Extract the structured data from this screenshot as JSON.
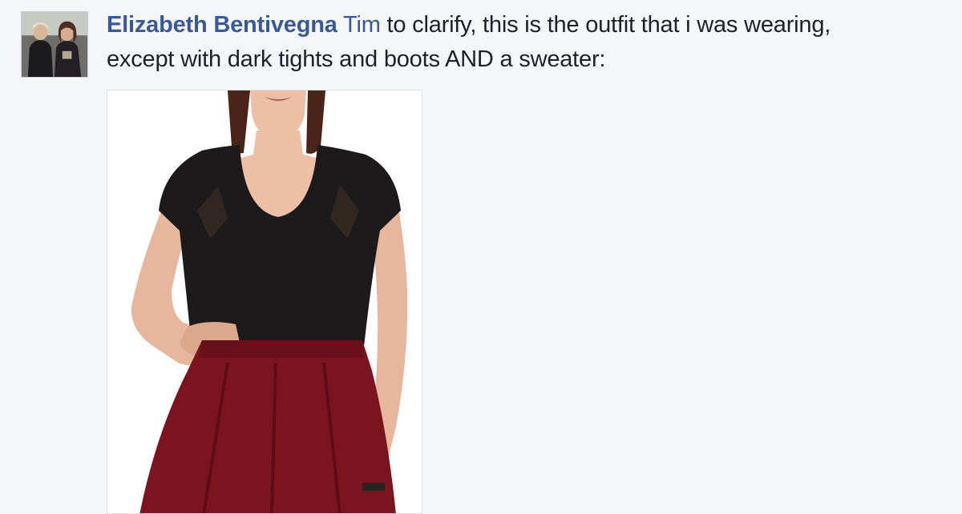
{
  "comment": {
    "author": "Elizabeth Bentivegna",
    "mention": "Tim",
    "text_line1": " to clarify, this is the outfit that i was wearing,",
    "text_line2": "except with dark tights and boots AND a sweater:"
  },
  "avatar": {
    "icon": "profile-photo-two-people"
  },
  "attachment": {
    "icon": "photo-woman-black-top-red-skirt"
  },
  "colors": {
    "link": "#3b5998",
    "text": "#1d2129",
    "background": "#f5f6f8",
    "top": "#1c1a1a",
    "skirt": "#7c1420"
  }
}
